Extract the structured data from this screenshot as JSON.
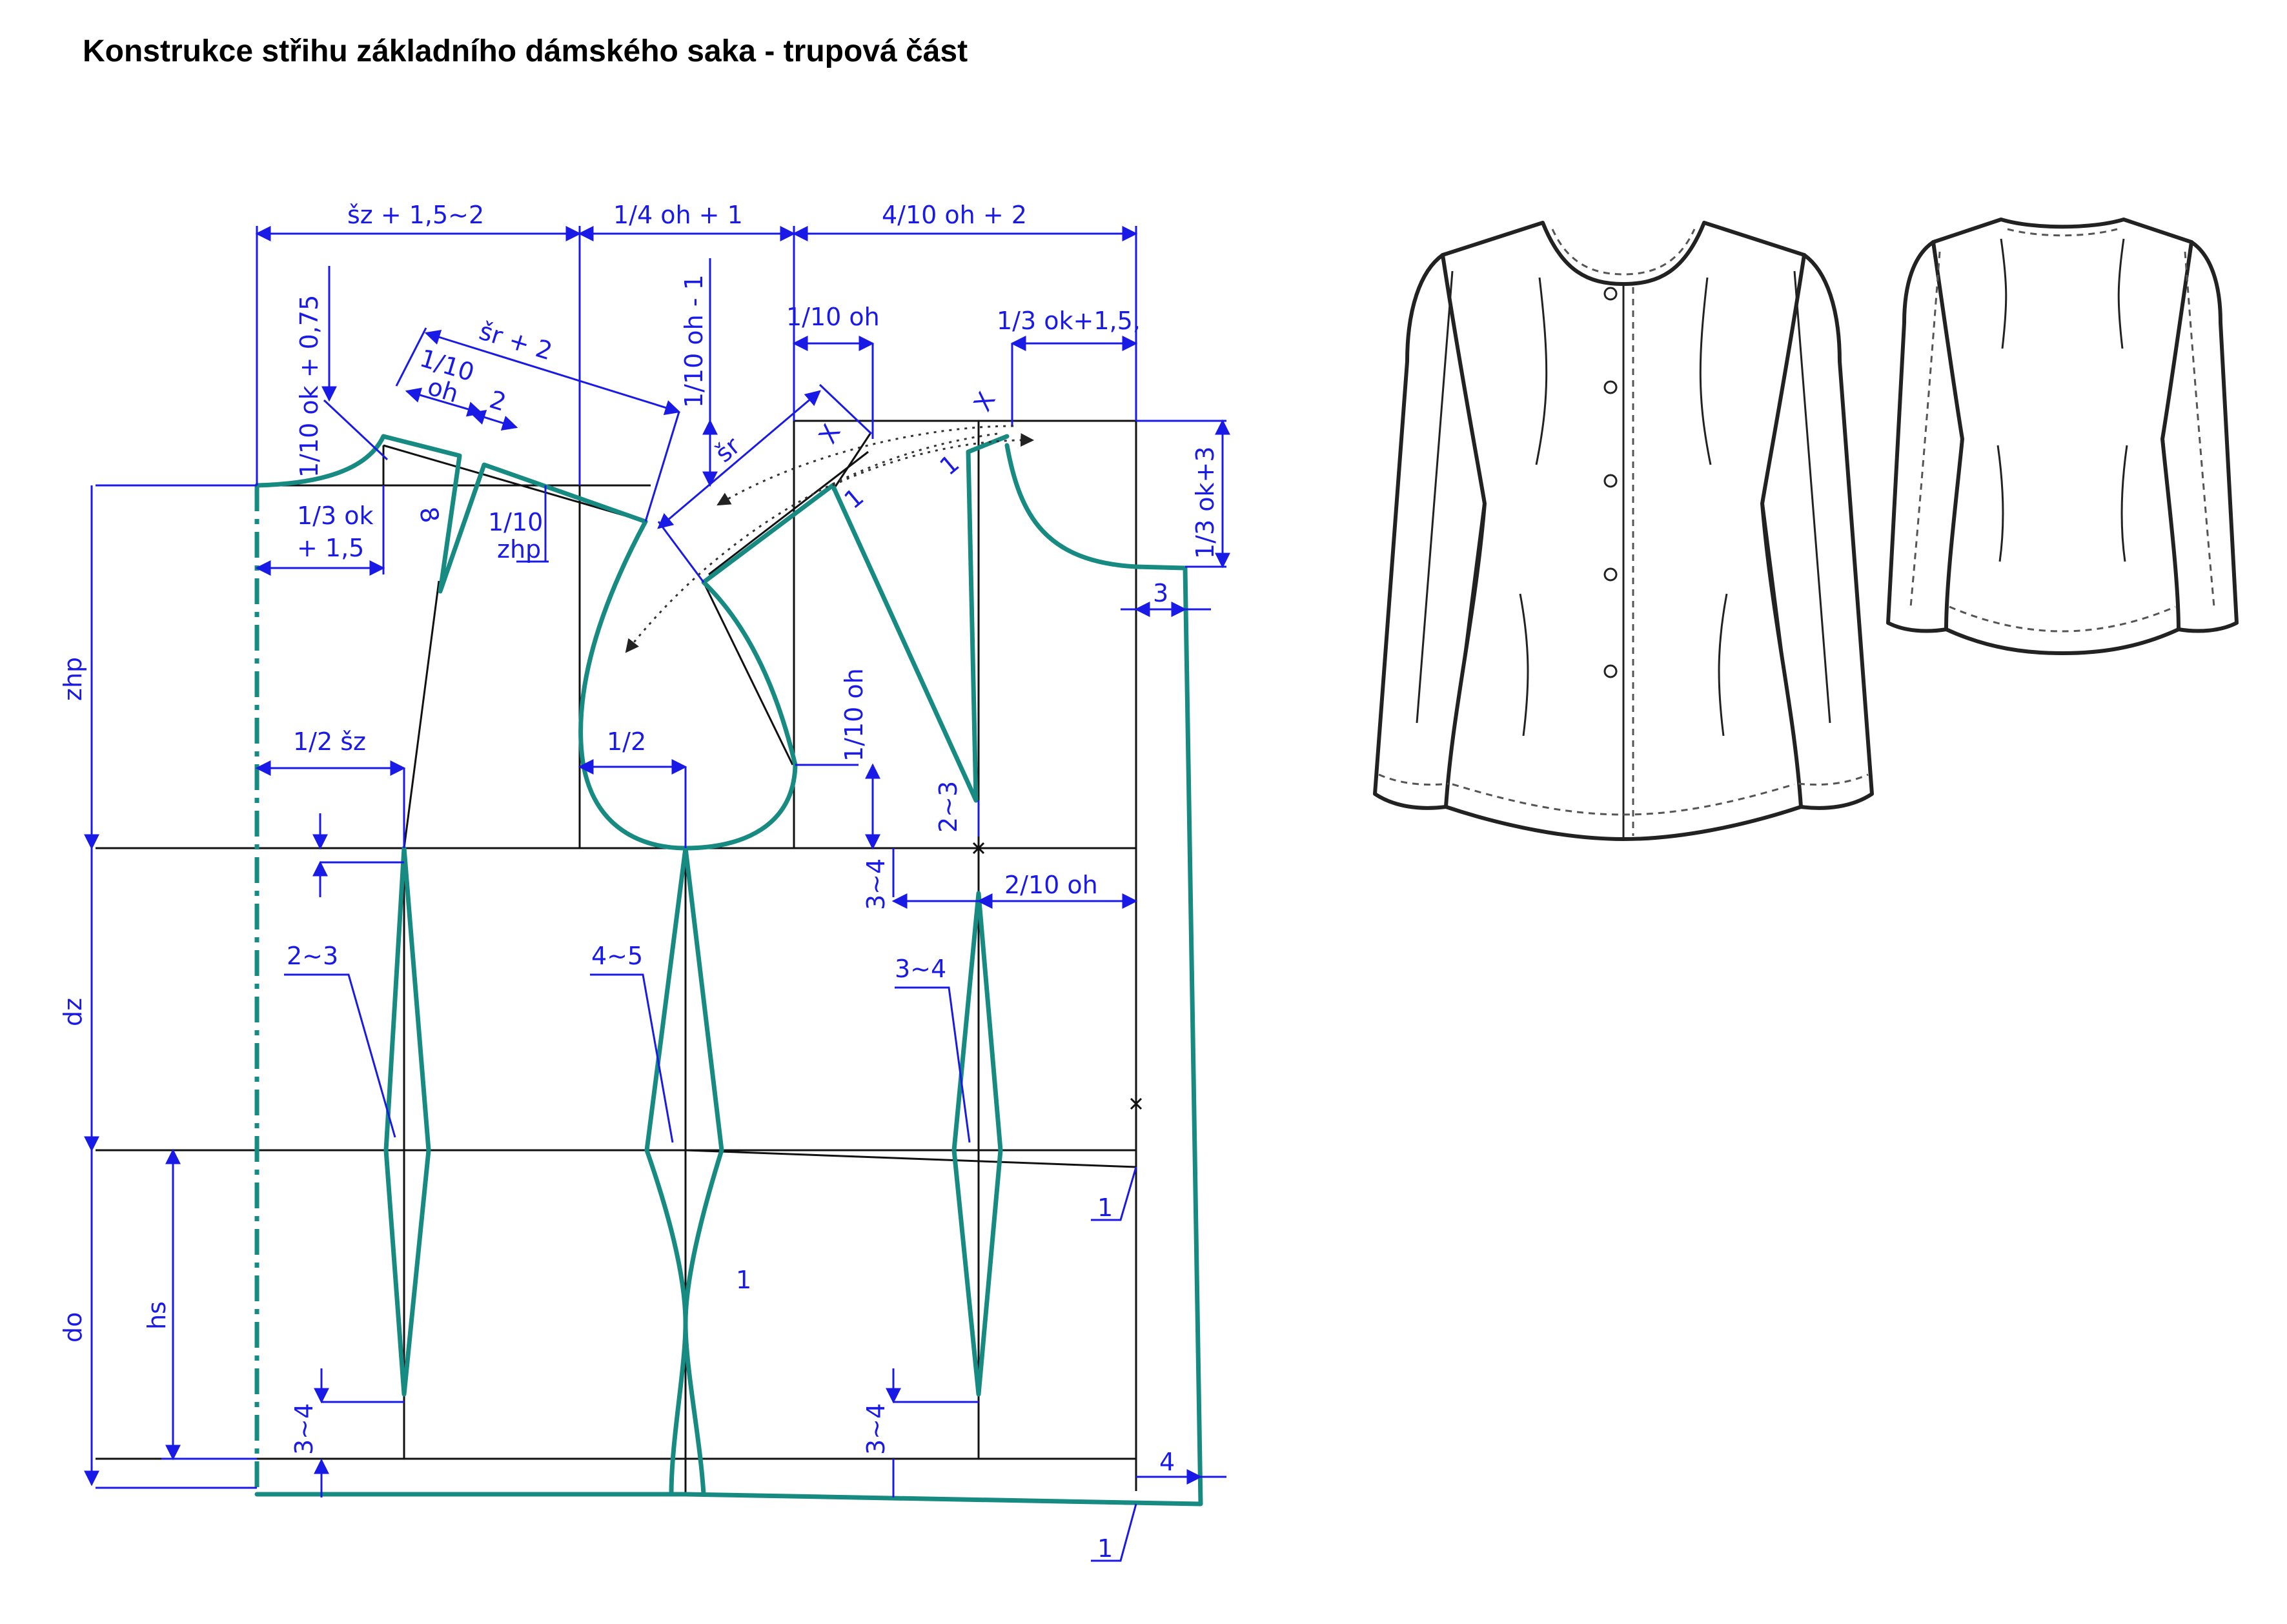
{
  "title": "Konstrukce střihu základního dámského saka - trupová část",
  "labels": {
    "sz_top": "šz + 1,5~2",
    "quarter_oh": "1/4 oh + 1",
    "four_tenth_oh": "4/10 oh + 2",
    "tenth_ok_075": "1/10 ok + 0,75",
    "tenth_oh_minus1": "1/10 oh - 1",
    "sr_plus2": "šr + 2",
    "tenth_oh_a": "1/10",
    "tenth_oh_b": "oh",
    "two_small": "2",
    "tenth_oh_front": "1/10 oh",
    "third_ok_15": "1/3 ok+1,5,",
    "sr": "šr",
    "x1": "X",
    "x2": "X",
    "one_a": "1",
    "one_b": "1",
    "eight": "8",
    "third_ok_a": "1/3 ok",
    "third_ok_b": "+ 1,5",
    "tenth_zhp_a": "1/10",
    "tenth_zhp_b": "zhp",
    "third_ok_3": "1/3 ok+3",
    "three": "3",
    "zhp": "zhp",
    "half_sz": "1/2 šz",
    "half": "1/2",
    "tenth_oh_vert": "1/10 oh",
    "two_three_v": "2~3",
    "three_four_a": "3~4",
    "two_tenth_oh": "2/10 oh",
    "two_three": "2~3",
    "four_five": "4~5",
    "three_four_b": "3~4",
    "dz": "dz",
    "one_c": "1",
    "hs": "hs",
    "do": "do",
    "one_mid": "1",
    "three_four_c": "3~4",
    "three_four_d": "3~4",
    "four": "4",
    "one_d": "1"
  }
}
